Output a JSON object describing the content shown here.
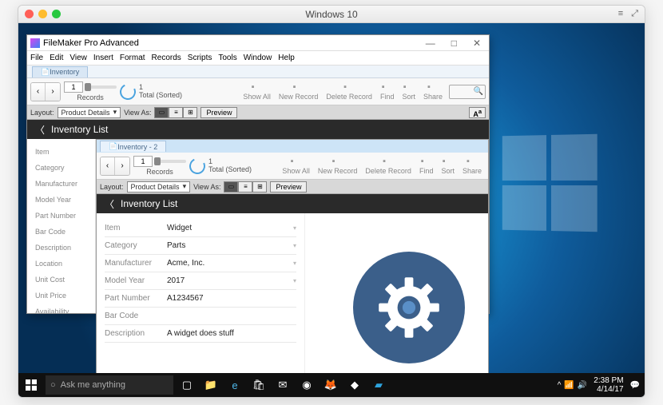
{
  "mac": {
    "title": "Windows 10"
  },
  "taskbar": {
    "search_placeholder": "Ask me anything",
    "time": "2:38 PM",
    "date": "4/14/17"
  },
  "fm": {
    "title": "FileMaker Pro Advanced",
    "menu": [
      "File",
      "Edit",
      "View",
      "Insert",
      "Format",
      "Records",
      "Scripts",
      "Tools",
      "Window",
      "Help"
    ],
    "tab": "Inventory",
    "record_num": "1",
    "record_total": "1",
    "record_status": "Total (Sorted)",
    "records_label": "Records",
    "actions": [
      "Show All",
      "New Record",
      "Delete Record",
      "Find",
      "Sort",
      "Share"
    ],
    "layout_label": "Layout:",
    "layout_value": "Product Details",
    "viewas_label": "View As:",
    "preview": "Preview",
    "aa": "A",
    "header": "Inventory List",
    "sidebar": [
      "Item",
      "Category",
      "Manufacturer",
      "Model Year",
      "Part Number",
      "Bar Code",
      "Description",
      "Location",
      "Unit Cost",
      "Unit Price",
      "Availability"
    ]
  },
  "doc": {
    "tab": "Inventory - 2",
    "fields": [
      {
        "label": "Item",
        "value": "Widget",
        "dd": true
      },
      {
        "label": "Category",
        "value": "Parts",
        "dd": true
      },
      {
        "label": "Manufacturer",
        "value": "Acme, Inc.",
        "dd": true
      },
      {
        "label": "Model Year",
        "value": "2017",
        "dd": true
      },
      {
        "label": "Part Number",
        "value": "A1234567",
        "dd": false
      },
      {
        "label": "Bar Code",
        "value": "",
        "dd": false
      },
      {
        "label": "Description",
        "value": "A widget does stuff",
        "dd": false
      }
    ]
  }
}
